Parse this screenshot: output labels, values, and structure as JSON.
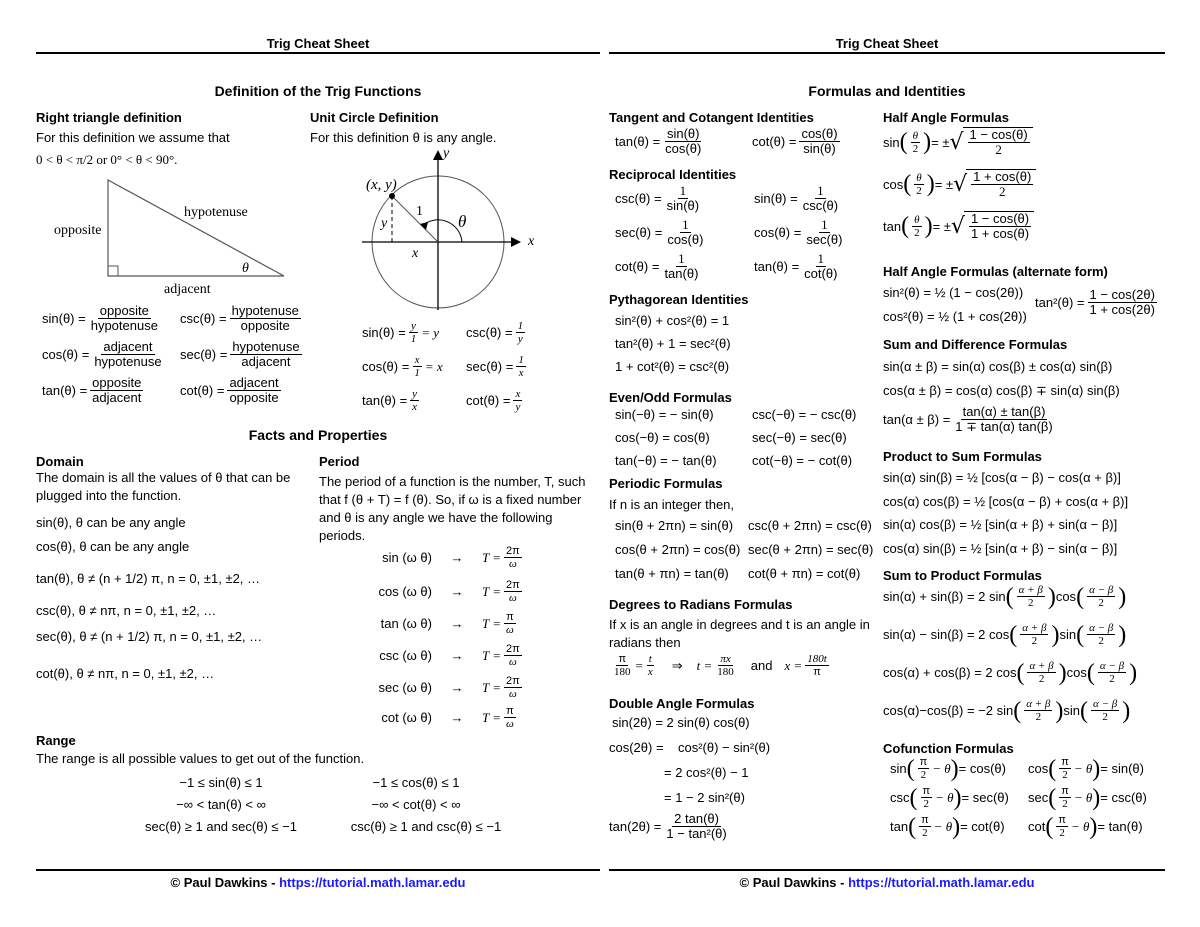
{
  "header_title": "Trig Cheat Sheet",
  "footer": {
    "author": "© Paul Dawkins - ",
    "link": "https://tutorial.math.lamar.edu",
    "link_color": "#1a1aff"
  },
  "left": {
    "title": "Definition of the Trig Functions",
    "right_triangle": {
      "heading": "Right triangle definition",
      "intro": "For this definition we assume that",
      "assumption": "0 < θ < π/2 or 0° < θ < 90°.",
      "labels": {
        "opposite": "opposite",
        "hypotenuse": "hypotenuse",
        "adjacent": "adjacent",
        "angle": "θ"
      },
      "defs": [
        {
          "fn": "sin(θ) =",
          "num": "opposite",
          "den": "hypotenuse"
        },
        {
          "fn": "csc(θ) =",
          "num": "hypotenuse",
          "den": "opposite"
        },
        {
          "fn": "cos(θ) =",
          "num": "adjacent",
          "den": "hypotenuse"
        },
        {
          "fn": "sec(θ) =",
          "num": "hypotenuse",
          "den": "adjacent"
        },
        {
          "fn": "tan(θ) =",
          "num": "opposite",
          "den": "adjacent"
        },
        {
          "fn": "cot(θ) =",
          "num": "adjacent",
          "den": "opposite"
        }
      ]
    },
    "unit_circle": {
      "heading": "Unit Circle Definition",
      "intro": "For this definition θ is any angle.",
      "labels": {
        "point": "(x, y)",
        "radius": "1",
        "angle": "θ",
        "x_axis": "x",
        "y_axis": "y",
        "x_seg": "x",
        "y_seg": "y"
      },
      "defs": [
        {
          "fn": "sin(θ) =",
          "num": "y",
          "den": "1",
          "tail": "= y"
        },
        {
          "fn": "csc(θ) =",
          "num": "1",
          "den": "y",
          "tail": ""
        },
        {
          "fn": "cos(θ) =",
          "num": "x",
          "den": "1",
          "tail": "= x"
        },
        {
          "fn": "sec(θ) =",
          "num": "1",
          "den": "x",
          "tail": ""
        },
        {
          "fn": "tan(θ) =",
          "num": "y",
          "den": "x",
          "tail": ""
        },
        {
          "fn": "cot(θ) =",
          "num": "x",
          "den": "y",
          "tail": ""
        }
      ]
    },
    "facts_title": "Facts and Properties",
    "domain": {
      "heading": "Domain",
      "intro": "The domain is all the values of θ that can be plugged into the function.",
      "items": [
        "sin(θ), θ can be any angle",
        "cos(θ), θ can be any angle",
        "tan(θ), θ ≠ (n + 1/2) π, n = 0, ±1, ±2, …",
        "csc(θ), θ ≠ nπ, n = 0, ±1, ±2, …",
        "sec(θ), θ ≠ (n + 1/2) π, n = 0, ±1, ±2, …",
        "cot(θ), θ ≠ nπ, n = 0, ±1, ±2, …"
      ]
    },
    "period": {
      "heading": "Period",
      "intro": "The period of a function is the number, T, such that f (θ + T) = f (θ). So, if ω is a fixed number and θ is any angle we have the following periods.",
      "items": [
        {
          "fn": "sin (ω θ)",
          "arrow": "→",
          "lhs": "T =",
          "num": "2π",
          "den": "ω"
        },
        {
          "fn": "cos (ω θ)",
          "arrow": "→",
          "lhs": "T =",
          "num": "2π",
          "den": "ω"
        },
        {
          "fn": "tan (ω θ)",
          "arrow": "→",
          "lhs": "T =",
          "num": "π",
          "den": "ω"
        },
        {
          "fn": "csc (ω θ)",
          "arrow": "→",
          "lhs": "T =",
          "num": "2π",
          "den": "ω"
        },
        {
          "fn": "sec (ω θ)",
          "arrow": "→",
          "lhs": "T =",
          "num": "2π",
          "den": "ω"
        },
        {
          "fn": "cot (ω θ)",
          "arrow": "→",
          "lhs": "T =",
          "num": "π",
          "den": "ω"
        }
      ]
    },
    "range": {
      "heading": "Range",
      "intro": "The range is all possible values to get out of the function.",
      "items": [
        "−1 ≤ sin(θ) ≤ 1",
        "−1 ≤ cos(θ) ≤ 1",
        "−∞ < tan(θ) < ∞",
        "−∞ < cot(θ) < ∞",
        "sec(θ) ≥ 1 and sec(θ) ≤ −1",
        "csc(θ) ≥ 1 and csc(θ) ≤ −1"
      ]
    }
  },
  "right": {
    "title": "Formulas and Identities",
    "tan_cot": {
      "heading": "Tangent and Cotangent Identities",
      "items": [
        {
          "fn": "tan(θ) =",
          "num": "sin(θ)",
          "den": "cos(θ)"
        },
        {
          "fn": "cot(θ) =",
          "num": "cos(θ)",
          "den": "sin(θ)"
        }
      ]
    },
    "reciprocal": {
      "heading": "Reciprocal Identities",
      "items": [
        {
          "fn": "csc(θ) =",
          "num": "1",
          "den": "sin(θ)"
        },
        {
          "fn": "sin(θ) =",
          "num": "1",
          "den": "csc(θ)"
        },
        {
          "fn": "sec(θ) =",
          "num": "1",
          "den": "cos(θ)"
        },
        {
          "fn": "cos(θ) =",
          "num": "1",
          "den": "sec(θ)"
        },
        {
          "fn": "cot(θ) =",
          "num": "1",
          "den": "tan(θ)"
        },
        {
          "fn": "tan(θ) =",
          "num": "1",
          "den": "cot(θ)"
        }
      ]
    },
    "pythagorean": {
      "heading": "Pythagorean Identities",
      "items": [
        "sin²(θ) + cos²(θ) = 1",
        "tan²(θ) + 1 = sec²(θ)",
        "1 + cot²(θ) = csc²(θ)"
      ]
    },
    "even_odd": {
      "heading": "Even/Odd Formulas",
      "items": [
        "sin(−θ) = − sin(θ)",
        "csc(−θ) = − csc(θ)",
        "cos(−θ) = cos(θ)",
        "sec(−θ) = sec(θ)",
        "tan(−θ) = − tan(θ)",
        "cot(−θ) = − cot(θ)"
      ]
    },
    "periodic": {
      "heading": "Periodic Formulas",
      "intro": "If n is an integer then,",
      "items": [
        "sin(θ + 2πn) = sin(θ)",
        "csc(θ + 2πn) = csc(θ)",
        "cos(θ + 2πn) = cos(θ)",
        "sec(θ + 2πn) = sec(θ)",
        "tan(θ + πn) = tan(θ)",
        "cot(θ + πn) = cot(θ)"
      ]
    },
    "deg_rad": {
      "heading": "Degrees to Radians Formulas",
      "intro": "If x is an angle in degrees and t is an angle in radians then",
      "f1_num": "π",
      "f1_den": "180",
      "eq": "=",
      "f2_num": "t",
      "f2_den": "x",
      "implies": "⇒",
      "t_eq": "t =",
      "f3_num": "πx",
      "f3_den": "180",
      "and": "and",
      "x_eq": "x =",
      "f4_num": "180t",
      "f4_den": "π"
    },
    "double_angle": {
      "heading": "Double Angle Formulas",
      "sin": "sin(2θ) = 2 sin(θ) cos(θ)",
      "cos_lhs": "cos(2θ) =",
      "cos_lines": [
        "cos²(θ) − sin²(θ)",
        "= 2 cos²(θ) − 1",
        "= 1 − 2 sin²(θ)"
      ],
      "tan_lhs": "tan(2θ) =",
      "tan_num": "2 tan(θ)",
      "tan_den": "1 − tan²(θ)"
    },
    "half_angle": {
      "heading": "Half Angle Formulas",
      "items": [
        {
          "fn": "sin",
          "num": "1 − cos(θ)",
          "den": "2"
        },
        {
          "fn": "cos",
          "num": "1 + cos(θ)",
          "den": "2"
        },
        {
          "fn": "tan",
          "num": "1 − cos(θ)",
          "den": "1 + cos(θ)"
        }
      ],
      "arg_num": "θ",
      "arg_den": "2",
      "pm": "= ±"
    },
    "half_angle_alt": {
      "heading": "Half Angle Formulas (alternate form)",
      "sin2": "sin²(θ) = ½ (1 − cos(2θ))",
      "cos2": "cos²(θ) = ½ (1 + cos(2θ))",
      "tan2_lhs": "tan²(θ) =",
      "tan2_num": "1 − cos(2θ)",
      "tan2_den": "1 + cos(2θ)"
    },
    "sum_diff": {
      "heading": "Sum and Difference Formulas",
      "sin": "sin(α ± β) = sin(α) cos(β) ± cos(α) sin(β)",
      "cos": "cos(α ± β) = cos(α) cos(β) ∓ sin(α) sin(β)",
      "tan_lhs": "tan(α ± β) =",
      "tan_num": "tan(α) ± tan(β)",
      "tan_den": "1 ∓ tan(α) tan(β)"
    },
    "product_sum": {
      "heading": "Product to Sum Formulas",
      "items": [
        "sin(α) sin(β) = ½ [cos(α − β) − cos(α + β)]",
        "cos(α) cos(β) = ½ [cos(α − β) + cos(α + β)]",
        "sin(α) cos(β) = ½ [sin(α + β) + sin(α − β)]",
        "cos(α) sin(β) = ½ [sin(α + β) − sin(α − β)]"
      ]
    },
    "sum_product": {
      "heading": "Sum to Product Formulas",
      "items": [
        {
          "lhs": "sin(α) + sin(β) = 2 sin",
          "mid": "cos"
        },
        {
          "lhs": "sin(α) − sin(β) = 2 cos",
          "mid": "sin"
        },
        {
          "lhs": "cos(α) + cos(β) = 2 cos",
          "mid": "cos"
        },
        {
          "lhs": "cos(α)−cos(β) = −2 sin",
          "mid": "sin"
        }
      ],
      "n1": "α + β",
      "n2": "α − β",
      "d": "2"
    },
    "cofunction": {
      "heading": "Cofunction Formulas",
      "items": [
        {
          "fn": "sin",
          "rhs": "= cos(θ)"
        },
        {
          "fn": "cos",
          "rhs": "= sin(θ)"
        },
        {
          "fn": "csc",
          "rhs": "= sec(θ)"
        },
        {
          "fn": "sec",
          "rhs": "= csc(θ)"
        },
        {
          "fn": "tan",
          "rhs": "= cot(θ)"
        },
        {
          "fn": "cot",
          "rhs": "= tan(θ)"
        }
      ],
      "pi": "π",
      "two": "2",
      "minus_theta": "− θ"
    }
  }
}
